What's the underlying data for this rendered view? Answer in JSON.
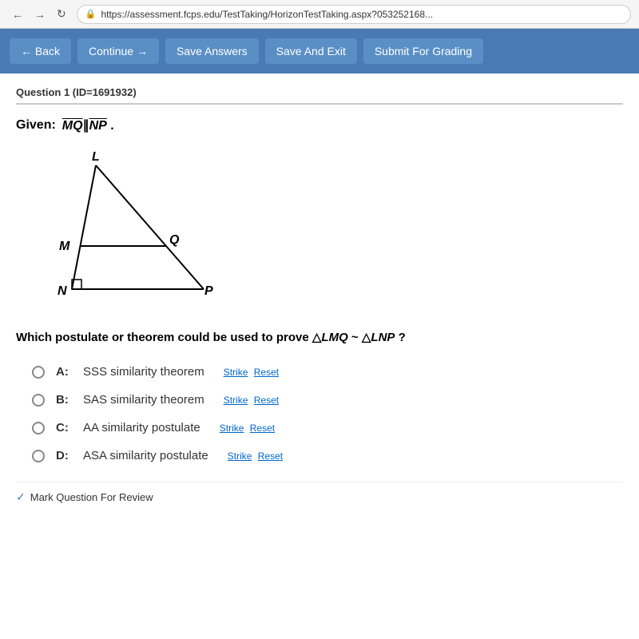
{
  "browser": {
    "back_btn": "←",
    "forward_btn": "→",
    "refresh_btn": "↻",
    "secure_label": "Secure",
    "url": "https://assessment.fcps.edu/TestTaking/HorizonTestTaking.aspx?053252168..."
  },
  "toolbar": {
    "back_label": "← Back",
    "continue_label": "Continue →",
    "save_answers_label": "Save Answers",
    "save_exit_label": "Save And Exit",
    "submit_label": "Submit For Grading"
  },
  "question": {
    "header": "Question 1 (ID=1691932)",
    "given_label": "Given:",
    "given_expression": "MQ∥NP",
    "given_expression_display": "MQ‖NP .",
    "body": "Which postulate or theorem could be used to prove △LMQ ~ △LNP ?",
    "answers": [
      {
        "id": "A",
        "text": "SSS similarity theorem",
        "strike_label": "Strike",
        "reset_label": "Reset"
      },
      {
        "id": "B",
        "text": "SAS similarity theorem",
        "strike_label": "Strike",
        "reset_label": "Reset"
      },
      {
        "id": "C",
        "text": "AA similarity postulate",
        "strike_label": "Strike",
        "reset_label": "Reset"
      },
      {
        "id": "D",
        "text": "ASA similarity postulate",
        "strike_label": "Strike",
        "reset_label": "Reset"
      }
    ],
    "mark_review_label": "Mark Question For Review",
    "figure_labels": {
      "L": "L",
      "M": "M",
      "Q": "Q",
      "N": "N",
      "P": "P"
    }
  }
}
